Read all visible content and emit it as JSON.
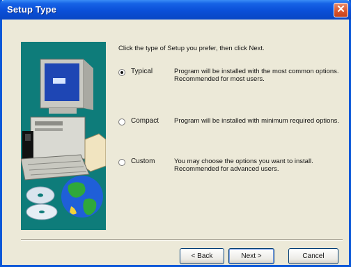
{
  "window": {
    "title": "Setup Type"
  },
  "titlebar": {
    "close_glyph": "✕"
  },
  "instruction": "Click the type of Setup you prefer, then click Next.",
  "options": [
    {
      "label": "Typical",
      "selected": true,
      "description": "Program will be installed with the most common options. Recommended for most users."
    },
    {
      "label": "Compact",
      "selected": false,
      "description": "Program will be installed with minimum required options."
    },
    {
      "label": "Custom",
      "selected": false,
      "description": "You may choose the options you want to install. Recommended for advanced users."
    }
  ],
  "buttons": {
    "back": "< Back",
    "next": "Next >",
    "cancel": "Cancel"
  },
  "colors": {
    "titlebar": "#0a4fd8",
    "panel": "#0e7c7a",
    "dialog_bg": "#ece9d8",
    "close_button": "#d9542a"
  },
  "icons": [
    "computer-icon",
    "cd-icon",
    "globe-icon",
    "close-icon"
  ]
}
